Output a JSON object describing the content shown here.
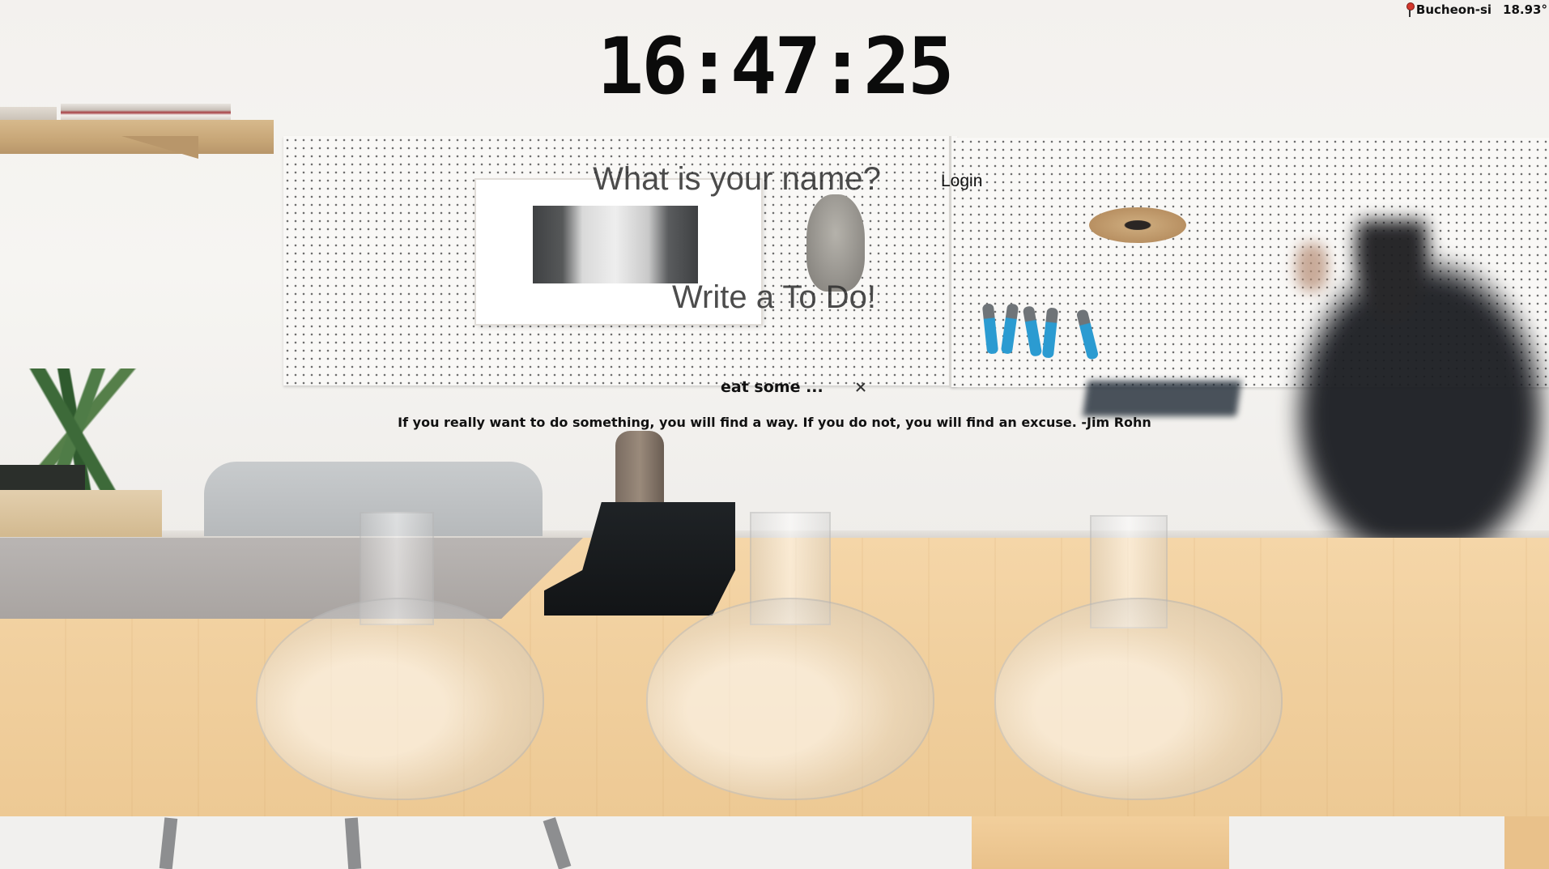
{
  "weather": {
    "location_icon": "map-pin-icon",
    "city": "Bucheon-si",
    "temperature": "18.93°"
  },
  "clock": {
    "time": "16:47:25"
  },
  "greeting": {
    "name_placeholder": "What is your name?",
    "login_label": "Login"
  },
  "todo": {
    "placeholder": "Write a To Do!",
    "items": [
      {
        "text": "eat some ...",
        "delete_icon": "close-icon"
      }
    ]
  },
  "quote": {
    "text": "If you really want to do something, you will find a way. If you do not, you will find an excuse. -Jim Rohn"
  },
  "colors": {
    "text": "#111111",
    "pin": "#d3372c"
  }
}
